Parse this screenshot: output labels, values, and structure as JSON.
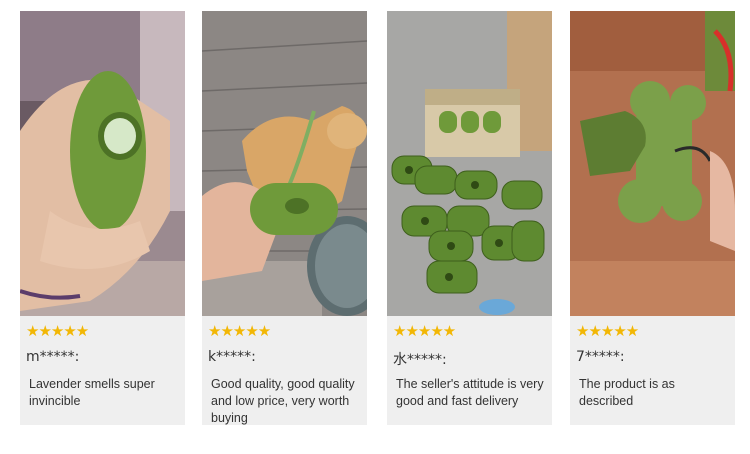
{
  "colors": {
    "star": "#f2b705",
    "card_background": "#efefef",
    "product_green": "#6f9a3a"
  },
  "reviews": [
    {
      "rating": 5,
      "stars": "★★★★★",
      "username": "m*****:",
      "text": "Lavender smells super invincible",
      "photo_icon": "hand-holding-green-bag-dispenser"
    },
    {
      "rating": 5,
      "stars": "★★★★★",
      "username": "k*****:",
      "text": "Good quality, good quality and low price, very worth buying",
      "photo_icon": "dog-walking-with-green-dispenser"
    },
    {
      "rating": 5,
      "stars": "★★★★★",
      "username": "水*****:",
      "text": "The seller's attitude is very good and fast delivery",
      "photo_icon": "pile-of-bone-shaped-dispensers"
    },
    {
      "rating": 5,
      "stars": "★★★★★",
      "username": "7*****:",
      "text": "The product is as described",
      "photo_icon": "bone-shaped-dispenser-with-bag"
    }
  ]
}
